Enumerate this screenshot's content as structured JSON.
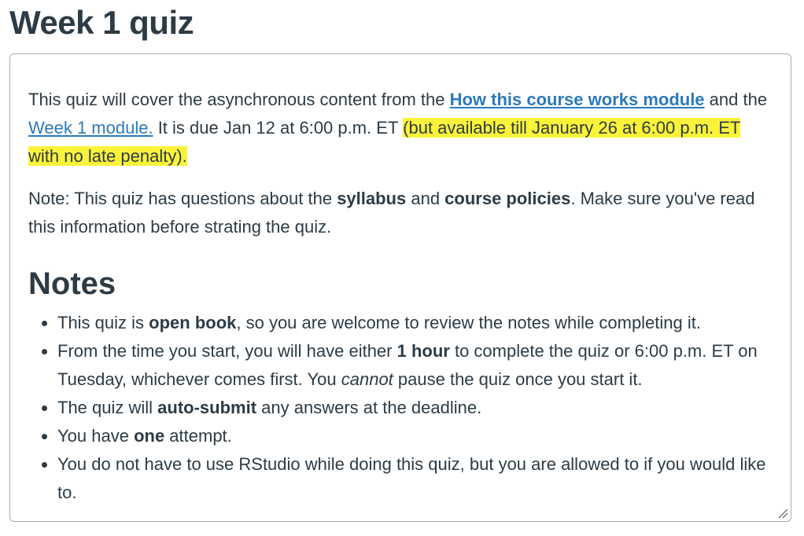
{
  "title": "Week 1 quiz",
  "intro": {
    "t1": "This quiz will cover the asynchronous content from the ",
    "link1": "How this course works module",
    "t2": " and the ",
    "link2": "Week 1 module.",
    "t3": " It is due Jan 12 at 6:00 p.m. ET ",
    "highlight": "(but available till January 26 at 6:00 p.m. ET with no late penalty).",
    "highlight_color": "#fbf33a",
    "link_color": "#2b7abc"
  },
  "note": {
    "t1": "Note: This quiz has questions about the ",
    "b1": "syllabus",
    "t2": " and ",
    "b2": "course policies",
    "t3": ". Make sure you've read this information before strating the quiz."
  },
  "notes_heading": "Notes",
  "bullets": [
    {
      "a": "This quiz is ",
      "b": "open book",
      "c": ", so you are welcome to review the notes while completing it."
    },
    {
      "a": "From the time you start, you will have either ",
      "b": "1 hour",
      "c": " to complete the quiz or 6:00 p.m. ET on Tuesday, whichever comes first. You ",
      "i": "cannot",
      "d": " pause the quiz once you start it."
    },
    {
      "a": "The quiz will ",
      "b": "auto-submit",
      "c": " any answers at the deadline."
    },
    {
      "a": "You have ",
      "b": "one",
      "c": " attempt."
    },
    {
      "a": "You do not have to use RStudio while doing this quiz, but you are allowed to if you would like to."
    }
  ],
  "icons": {
    "resize": "resize-handle-icon"
  }
}
